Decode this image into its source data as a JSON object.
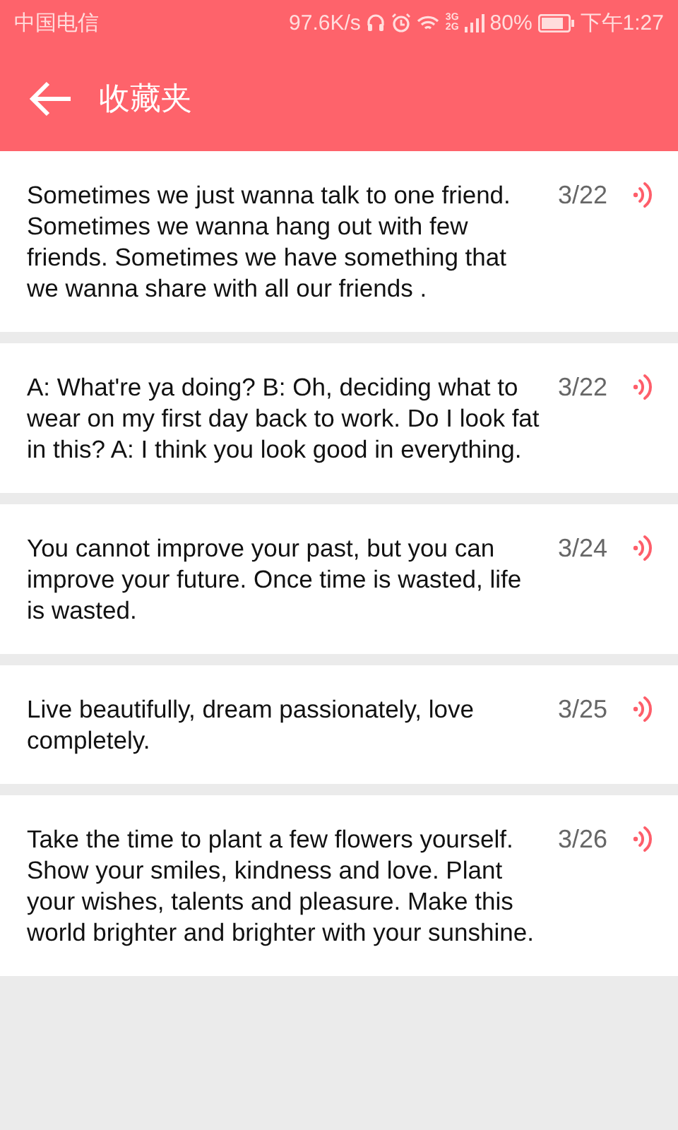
{
  "status_bar": {
    "carrier": "中国电信",
    "speed": "97.6K/s",
    "network_top": "3G",
    "network_bottom": "2G",
    "battery": "80%",
    "time": "下午1:27"
  },
  "header": {
    "title": "收藏夹"
  },
  "favorites": [
    {
      "text": "Sometimes we just wanna talk to one friend. Sometimes we wanna hang out with few friends. Sometimes we have something that we wanna share with all our friends .",
      "date": "3/22"
    },
    {
      "text": "A: What're ya doing?  B: Oh, deciding what to wear on my first day back to work. Do I look fat in this? A: I think you look good in everything.",
      "date": "3/22"
    },
    {
      "text": "You cannot improve your past, but you can improve your future. Once time is wasted, life is wasted.",
      "date": "3/24"
    },
    {
      "text": "Live beautifully, dream passionately, love completely.",
      "date": "3/25"
    },
    {
      "text": "Take the time to plant a few flowers yourself. Show your smiles, kindness and love. Plant your wishes, talents and pleasure. Make this world brighter and brighter with your sunshine.",
      "date": "3/26"
    }
  ]
}
